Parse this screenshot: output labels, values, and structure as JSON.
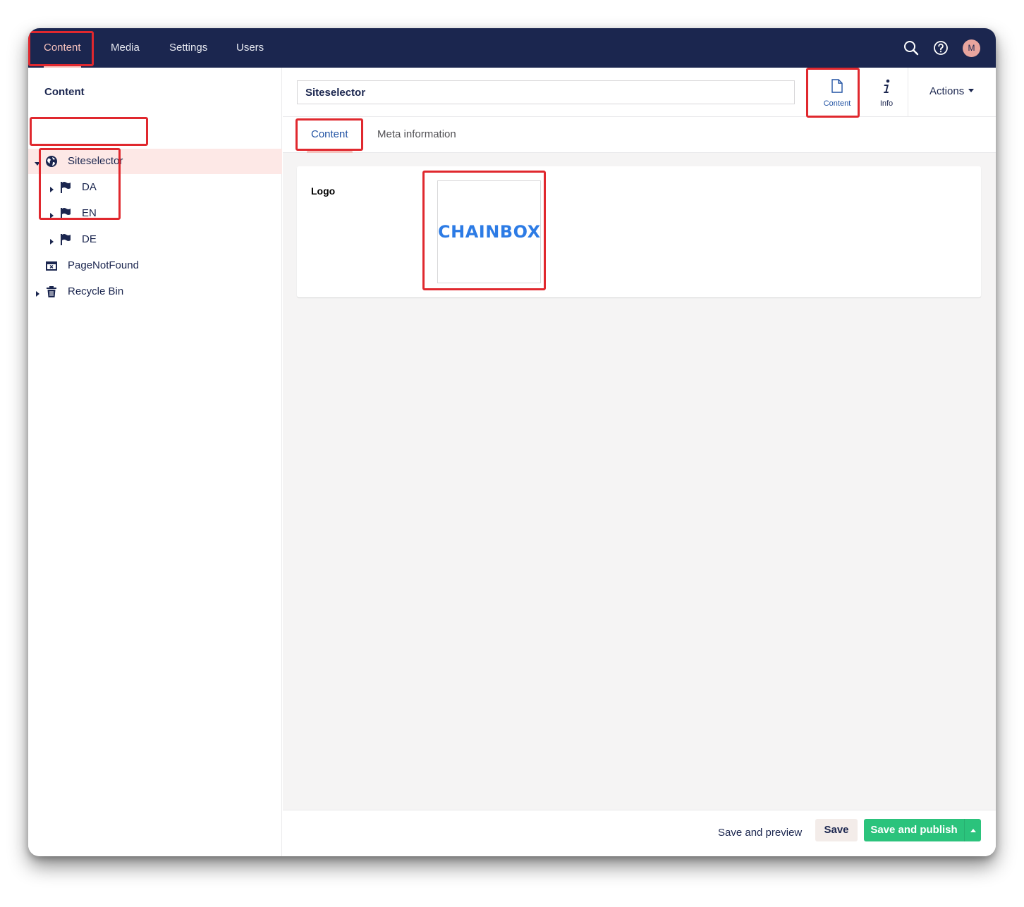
{
  "header": {
    "nav": [
      {
        "label": "Content",
        "active": true
      },
      {
        "label": "Media"
      },
      {
        "label": "Settings"
      },
      {
        "label": "Users"
      }
    ],
    "icons": [
      "search-icon",
      "help-icon"
    ],
    "avatar_initial": "M"
  },
  "sidebar": {
    "title": "Content",
    "tree": [
      {
        "label": "Siteselector",
        "icon": "globe-icon",
        "expanded": true,
        "selected": true
      },
      {
        "label": "DA",
        "icon": "flag-icon"
      },
      {
        "label": "EN",
        "icon": "flag-icon"
      },
      {
        "label": "DE",
        "icon": "flag-icon"
      },
      {
        "label": "PageNotFound",
        "icon": "window-close-icon"
      },
      {
        "label": "Recycle Bin",
        "icon": "trash-icon"
      }
    ]
  },
  "editor": {
    "name_value": "Siteselector",
    "apps": [
      {
        "label": "Content",
        "icon": "document-icon",
        "active": true
      },
      {
        "label": "Info",
        "icon": "info-icon"
      }
    ],
    "actions_label": "Actions",
    "tabs": [
      {
        "label": "Content",
        "active": true
      },
      {
        "label": "Meta information"
      }
    ],
    "property": {
      "label": "Logo",
      "image_text": "CHAINBOX"
    },
    "footer": {
      "save_preview": "Save and preview",
      "save": "Save",
      "publish": "Save and publish"
    }
  },
  "colors": {
    "header_bg": "#1b264f",
    "accent_pink": "#f5c1bc",
    "selected_row": "#fde8e6",
    "publish_green": "#2bc37c",
    "logo_blue": "#2c7be5",
    "highlight_red": "#e0282e"
  }
}
